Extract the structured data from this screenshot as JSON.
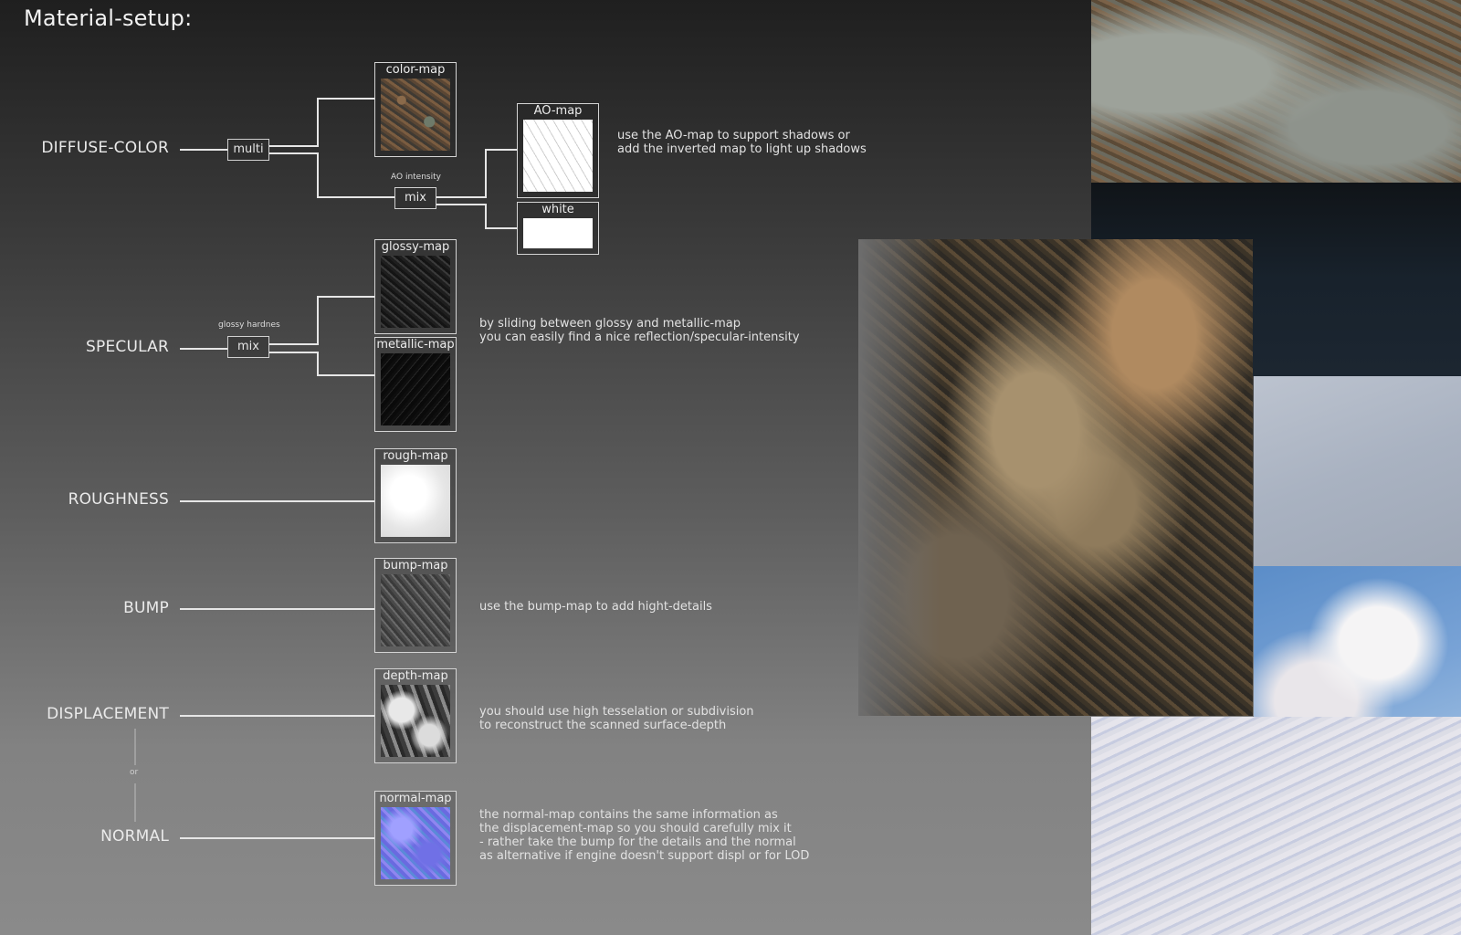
{
  "title": "Material-setup:",
  "channels": {
    "diffuse": "DIFFUSE-COLOR",
    "specular": "SPECULAR",
    "roughness": "ROUGHNESS",
    "bump": "BUMP",
    "displacement": "DISPLACEMENT",
    "normal": "NORMAL",
    "or": "or"
  },
  "nodes": {
    "multi": "multi",
    "mix_ao": "mix",
    "mix_specular": "mix",
    "ao_intensity": "AO intensity",
    "glossy_hardness": "glossy hardnes"
  },
  "maps": {
    "color": "color-map",
    "ao": "AO-map",
    "white": "white",
    "glossy": "glossy-map",
    "metallic": "metallic-map",
    "rough": "rough-map",
    "bump": "bump-map",
    "depth": "depth-map",
    "normal": "normal-map"
  },
  "notes": {
    "ao": [
      "use the AO-map to support shadows or",
      "add the inverted map to light up shadows"
    ],
    "specular": [
      "by sliding between glossy and metallic-map",
      "you can easily find a nice reflection/specular-intensity"
    ],
    "bump": [
      "use the bump-map to add hight-details"
    ],
    "displacement": [
      "you should use high tesselation or subdivision",
      "to reconstruct the scanned surface-depth"
    ],
    "normal": [
      "the normal-map contains the same information as",
      "the displacement-map so you should carefully mix it",
      "- rather take the bump for the details and the normal",
      "as alternative if engine doesn't support displ or for LOD"
    ]
  }
}
